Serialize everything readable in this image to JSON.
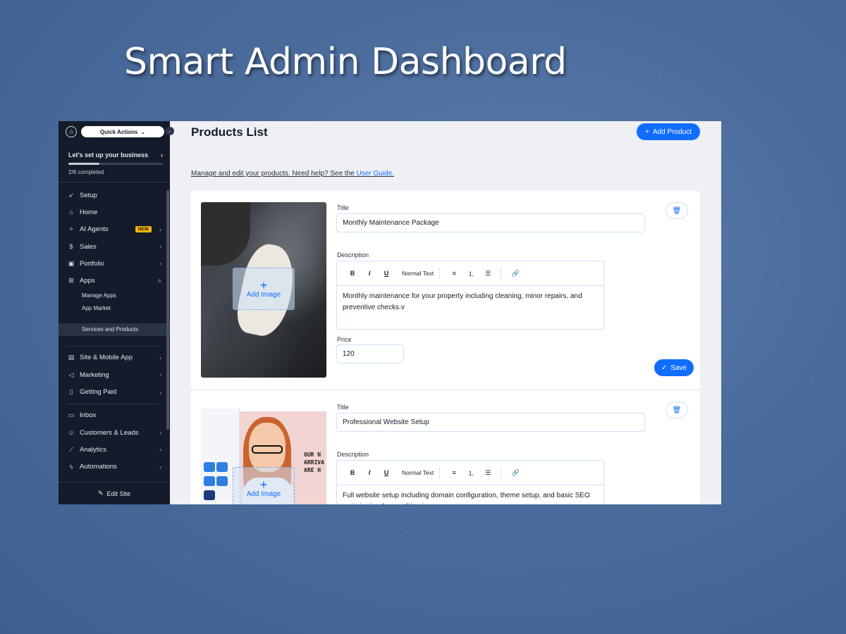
{
  "hero": {
    "title": "Smart Admin Dashboard"
  },
  "sidebar": {
    "quick_actions": "Quick Actions",
    "setup_title": "Let's set up your business",
    "progress_text": "2/6 completed",
    "progress_fraction": 0.33,
    "items": [
      {
        "label": "Setup",
        "icon": "rocket-icon"
      },
      {
        "label": "Home",
        "icon": "home-icon"
      },
      {
        "label": "AI Agents",
        "icon": "sparkle-icon",
        "badge": "NEW"
      },
      {
        "label": "Sales",
        "icon": "dollar-icon"
      },
      {
        "label": "Portfolio",
        "icon": "portfolio-icon"
      },
      {
        "label": "Apps",
        "icon": "apps-icon"
      }
    ],
    "apps_sub": [
      "Manage Apps",
      "App Market",
      "Services and Products"
    ],
    "items2": [
      {
        "label": "Site & Mobile App",
        "icon": "site-icon"
      },
      {
        "label": "Marketing",
        "icon": "megaphone-icon"
      },
      {
        "label": "Getting Paid",
        "icon": "invoice-icon"
      }
    ],
    "items3": [
      {
        "label": "Inbox",
        "icon": "inbox-icon"
      },
      {
        "label": "Customers & Leads",
        "icon": "customers-icon"
      },
      {
        "label": "Analytics",
        "icon": "analytics-icon"
      },
      {
        "label": "Automations",
        "icon": "automation-icon"
      }
    ],
    "edit_site": "Edit Site"
  },
  "main": {
    "title": "Products List",
    "add_product": "Add Product",
    "intro_text": "Manage and edit your products. Need help? See the ",
    "intro_link": "User Guide.",
    "labels": {
      "title": "Title",
      "description": "Description",
      "price": "Price",
      "add_image": "Add Image",
      "save": "Save",
      "normal_text": "Normal Text"
    },
    "products": [
      {
        "title": "Monthly Maintenance Package",
        "description": "Monthly maintenance for your property including cleaning, minor repairs, and preventive checks.v",
        "price": "120"
      },
      {
        "title": "Professional Website Setup",
        "description": "Full website setup including domain configuration, theme setup, and basic SEO optimization for small businesses."
      }
    ],
    "mock_text": "OUR N\nARRIVA\nARE H"
  },
  "colors": {
    "accent": "#116dff",
    "sidebar_bg": "#141c2b",
    "badge": "#f7b500"
  }
}
